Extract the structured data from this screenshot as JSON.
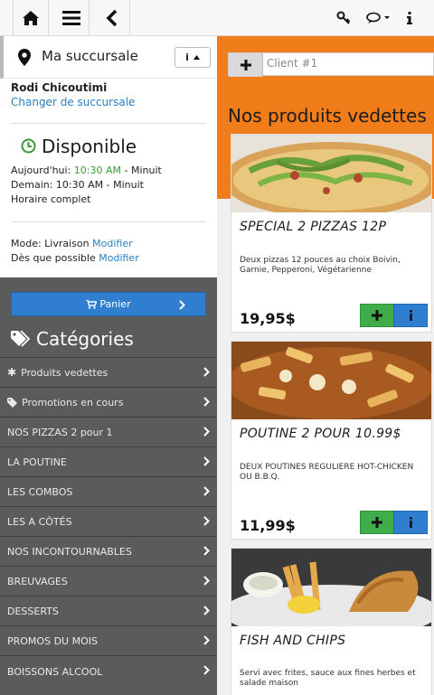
{
  "topbar": {
    "icons": [
      "home-icon",
      "menu-icon",
      "back-icon",
      "key-icon",
      "chat-icon",
      "info-icon"
    ]
  },
  "branch": {
    "header_label": "Ma succursale",
    "info_button_label": "i",
    "name": "Rodi Chicoutimi",
    "change_link": "Changer de succursale",
    "status": "Disponible",
    "today_label": "Aujourd'hui:",
    "today_open": "10:30 AM",
    "today_close": "- Minuit",
    "tomorrow_line": "Demain: 10:30 AM - Minuit",
    "full_schedule": "Horaire complet",
    "mode_label": "Mode: Livraison",
    "mode_link": "Modifier",
    "time_label": "Dès que possible",
    "time_link": "Modifier"
  },
  "sidebar": {
    "cart_label": "Panier",
    "categories_title": "Catégories",
    "categories": [
      {
        "label": "Produits vedettes",
        "icon": "asterisk-icon"
      },
      {
        "label": "Promotions en cours",
        "icon": "tag-icon"
      },
      {
        "label": "NOS PIZZAS 2 pour 1"
      },
      {
        "label": "LA POUTINE"
      },
      {
        "label": "LES COMBOS"
      },
      {
        "label": "LES A CÔTÉS"
      },
      {
        "label": "NOS INCONTOURNABLES"
      },
      {
        "label": "BREUVAGES"
      },
      {
        "label": "DESSERTS"
      },
      {
        "label": "PROMOS DU MOIS"
      },
      {
        "label": "BOISSONS ALCOOL"
      }
    ]
  },
  "main": {
    "client_label": "Client #1",
    "featured_title": "Nos produits vedettes",
    "products": [
      {
        "title": "SPECIAL 2 PIZZAS 12P",
        "description": "Deux pizzas 12 pouces au choix Boivin, Garnie, Pepperoni, Végétarienne",
        "price": "19,95$"
      },
      {
        "title": "POUTINE 2 POUR 10.99$",
        "description": "DEUX POUTINES REGULIERE HOT-CHICKEN OU B.B.Q.",
        "price": "11,99$"
      },
      {
        "title": "FISH AND CHIPS",
        "description": "Servi avec frites, sauce aux fines herbes et salade maison",
        "price": ""
      }
    ]
  },
  "colors": {
    "accent_orange": "#f07d1a",
    "primary_blue": "#2f7ed0",
    "add_green": "#3fae4a",
    "sidebar_dark": "#5b5b5b",
    "link_blue": "#2a7fc1",
    "open_green": "#3a9a3a"
  }
}
